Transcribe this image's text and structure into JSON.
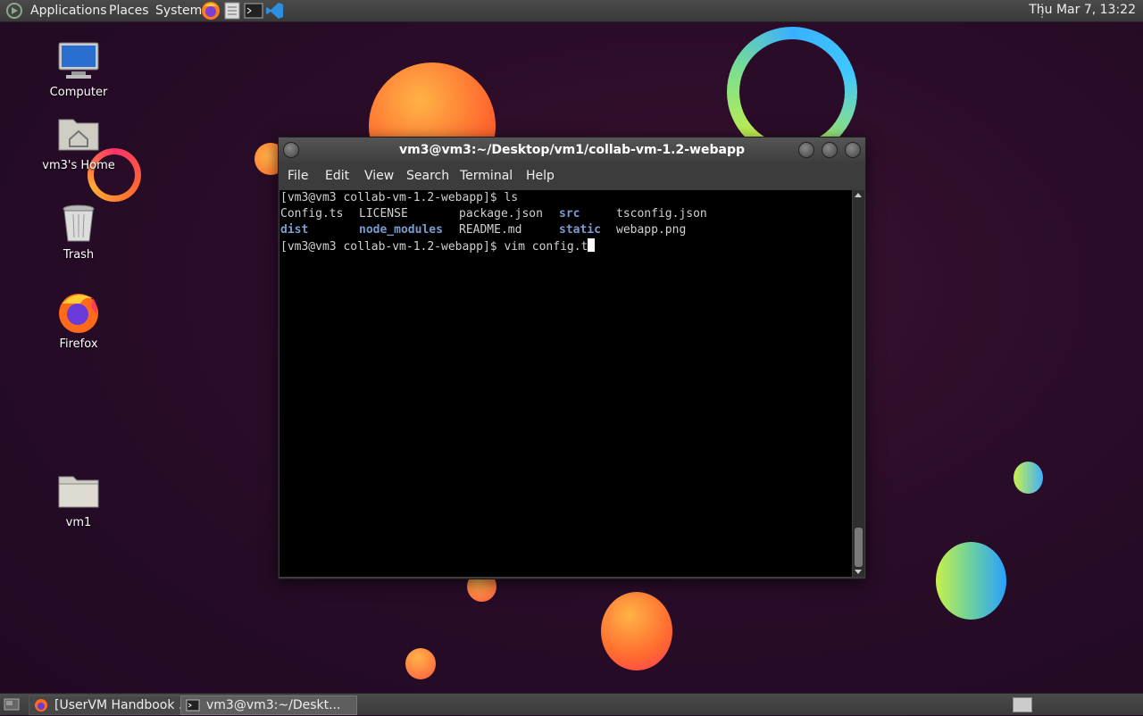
{
  "top_panel": {
    "menus": [
      "Applications",
      "Places",
      "System"
    ],
    "launchers": [
      "firefox-icon",
      "text-editor-icon",
      "terminal-icon",
      "vscode-icon"
    ],
    "clock": "Thu Mar  7, 13:22"
  },
  "desktop_icons": [
    {
      "label": "Computer",
      "icon": "computer-icon"
    },
    {
      "label": "vm3's Home",
      "icon": "home-folder-icon"
    },
    {
      "label": "Trash",
      "icon": "trash-icon"
    },
    {
      "label": "Firefox",
      "icon": "firefox-icon"
    },
    {
      "label": "vm1",
      "icon": "folder-icon"
    }
  ],
  "terminal": {
    "title": "vm3@vm3:~/Desktop/vm1/collab-vm-1.2-webapp",
    "menu": [
      "File",
      "Edit",
      "View",
      "Search",
      "Terminal",
      "Help"
    ],
    "line1": "[vm3@vm3 collab-vm-1.2-webapp]$ ls",
    "ls_rows": [
      [
        "Config.ts",
        "LICENSE",
        "package.json",
        "src",
        "tsconfig.json"
      ],
      [
        "dist",
        "node_modules",
        "README.md",
        "static",
        "webapp.png"
      ]
    ],
    "line_last": "[vm3@vm3 collab-vm-1.2-webapp]$ vim config.t"
  },
  "taskbar": {
    "items": [
      "[UserVM Handbook ...",
      "vm3@vm3:~/Deskt..."
    ]
  },
  "colors": {
    "panel": "#3f3f3f",
    "terminal_bg": "#000000",
    "directory": "#7a9bd0",
    "desktop": "#2a0c28"
  }
}
